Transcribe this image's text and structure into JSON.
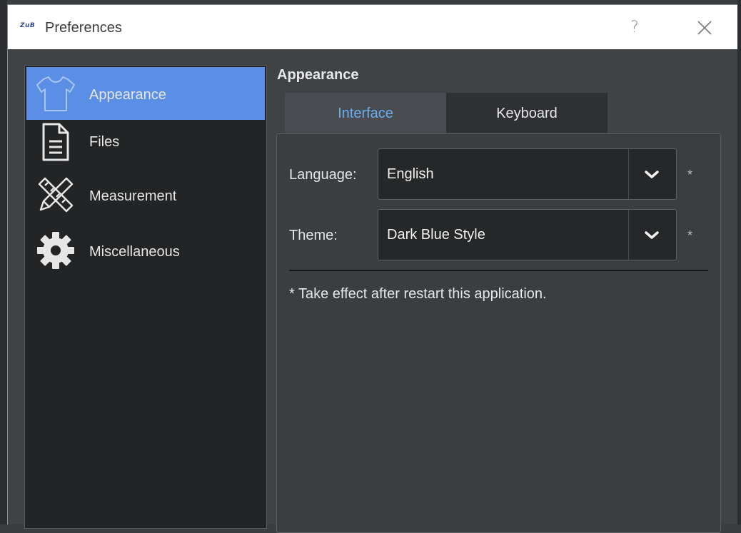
{
  "window": {
    "app_logo": "ZuB",
    "title": "Preferences",
    "help_label": "?"
  },
  "sidebar": {
    "items": [
      {
        "label": "Appearance",
        "icon": "shirt-icon",
        "active": true
      },
      {
        "label": "Files",
        "icon": "document-icon",
        "active": false
      },
      {
        "label": "Measurement",
        "icon": "pencil-ruler-icon",
        "active": false
      },
      {
        "label": "Miscellaneous",
        "icon": "gear-icon",
        "active": false
      }
    ]
  },
  "main": {
    "section_title": "Appearance",
    "tabs": [
      {
        "label": "Interface",
        "active": true
      },
      {
        "label": "Keyboard",
        "active": false
      }
    ],
    "fields": [
      {
        "label": "Language:",
        "value": "English",
        "required_mark": "*"
      },
      {
        "label": "Theme:",
        "value": "Dark Blue Style",
        "required_mark": "*"
      }
    ],
    "note": "* Take effect after restart this application."
  },
  "colors": {
    "accent": "#5b8fe6",
    "active_tab_text": "#6aaef0",
    "panel_bg": "#3b3e41",
    "sidebar_bg": "#232425"
  }
}
